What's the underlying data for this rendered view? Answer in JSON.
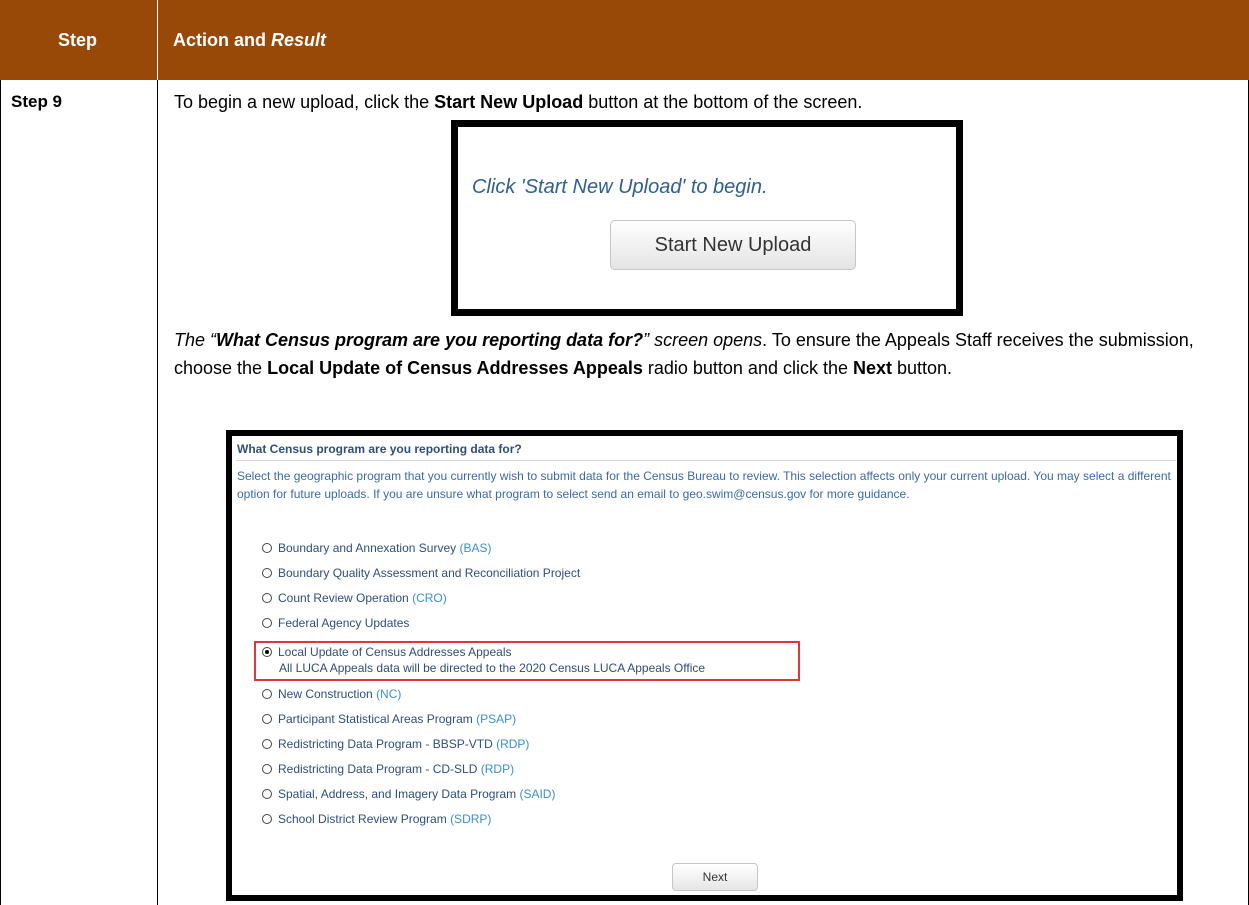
{
  "header": {
    "step_label": "Step",
    "action_label": "Action and",
    "result_label": "Result"
  },
  "row": {
    "step": "Step 9",
    "p1": {
      "a": "To begin a new upload, click the ",
      "b": "Start New Upload",
      "c": " button at the bottom of the screen."
    },
    "p2": {
      "a": "The “",
      "b": "What Census program are you reporting data for?",
      "c": "” screen opens",
      "d": ". To ensure the Appeals Staff receives the submission, choose the ",
      "e": "Local Update of Census Addresses Appeals",
      "f": " radio button and click the ",
      "g": "Next",
      "h": " button."
    }
  },
  "screenshot1": {
    "prompt": "Click 'Start New Upload' to begin.",
    "button": "Start New Upload"
  },
  "screenshot2": {
    "title": "What Census program are you reporting data for?",
    "description_a": "Select the geographic program that you currently wish to submit data for the Census Bureau to review. This selection affects only your current upload. You may select a different option for future uploads. If you are unsure what program to select send an email to ",
    "email": "geo.swim@census.gov",
    "description_b": " for more guidance.",
    "options": [
      {
        "label": "Boundary and Annexation Survey",
        "abbr": "(BAS)"
      },
      {
        "label": "Boundary Quality Assessment and Reconciliation Project",
        "abbr": ""
      },
      {
        "label": "Count Review Operation",
        "abbr": "(CRO)"
      },
      {
        "label": "Federal Agency Updates",
        "abbr": ""
      },
      {
        "label": "Local Update of Census Addresses Appeals",
        "abbr": "",
        "note": "All LUCA Appeals data will be directed to the 2020 Census LUCA Appeals Office",
        "selected": true
      },
      {
        "label": "New Construction",
        "abbr": "(NC)"
      },
      {
        "label": "Participant Statistical Areas Program",
        "abbr": "(PSAP)"
      },
      {
        "label": "Redistricting Data Program - BBSP-VTD",
        "abbr": "(RDP)"
      },
      {
        "label": "Redistricting Data Program - CD-SLD",
        "abbr": "(RDP)"
      },
      {
        "label": "Spatial, Address, and Imagery Data Program",
        "abbr": "(SAID)"
      },
      {
        "label": "School District Review Program",
        "abbr": "(SDRP)"
      }
    ],
    "next_button": "Next"
  },
  "colors": {
    "header_bg": "#984807",
    "highlight_border": "#e0363b",
    "link": "#3a8ed0"
  }
}
